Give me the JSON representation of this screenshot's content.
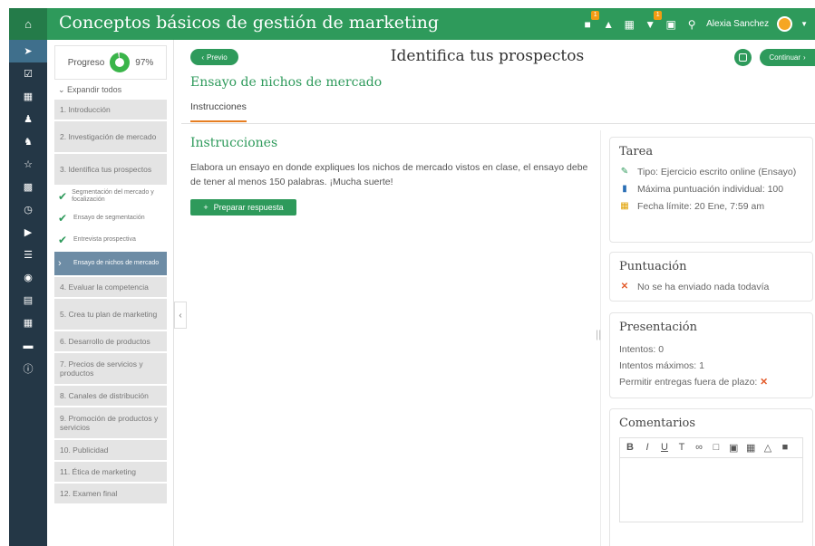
{
  "app": {
    "title": "Conceptos básicos de gestión de marketing"
  },
  "topbar": {
    "badge_1": "1",
    "badge_2": "1",
    "user_name": "Alexia Sanchez"
  },
  "outline": {
    "progress_label": "Progreso",
    "progress_percent": 97,
    "progress_text": "97%",
    "expand_label": "Expandir todos",
    "chapters_top": [
      {
        "label": "1. Introducción",
        "size": "one"
      },
      {
        "label": "2. Investigación de mercado",
        "size": "two"
      },
      {
        "label": "3. Identifica tus prospectos",
        "size": "two"
      }
    ],
    "subitems": [
      {
        "label": "Segmentación del mercado y focalización"
      },
      {
        "label": "Ensayo de segmentación"
      },
      {
        "label": "Entrevista prospectiva"
      }
    ],
    "current_item": "Ensayo de nichos de mercado",
    "chapters_bottom": [
      {
        "label": "4. Evaluar la competencia",
        "size": "one"
      },
      {
        "label": "5. Crea tu plan de marketing",
        "size": "two"
      },
      {
        "label": "6. Desarrollo de productos",
        "size": "one"
      },
      {
        "label": "7. Precios de servicios y productos",
        "size": "two"
      },
      {
        "label": "8. Canales de distribución",
        "size": "one"
      },
      {
        "label": "9. Promoción de productos y servicios",
        "size": "two"
      },
      {
        "label": "10. Publicidad",
        "size": "one"
      },
      {
        "label": "11. Ética de marketing",
        "size": "one"
      },
      {
        "label": "12. Examen final",
        "size": "one"
      }
    ]
  },
  "main": {
    "prev_label": "Previo",
    "page_title": "Identifica tus prospectos",
    "next_label": "Continuar",
    "assignment_title": "Ensayo de nichos de mercado",
    "tab_label": "Instrucciones",
    "section_title": "Instrucciones",
    "instructions": "Elabora un ensayo en donde expliques los nichos de mercado vistos en clase, el ensayo debe de tener al menos 150 palabras. ¡Mucha suerte!",
    "prepare_label": "Preparar respuesta"
  },
  "task_card": {
    "title": "Tarea",
    "type": "Tipo: Ejercicio escrito online (Ensayo)",
    "max_score": "Máxima puntuación individual: 100",
    "deadline": "Fecha límite: 20 Ene, 7:59 am"
  },
  "score_card": {
    "title": "Puntuación",
    "status": "No se ha enviado nada todavía"
  },
  "submission_card": {
    "title": "Presentación",
    "attempts": "Intentos: 0",
    "max_attempts": "Intentos máximos: 1",
    "late": "Permitir entregas fuera de plazo:"
  },
  "comments_card": {
    "title": "Comentarios"
  }
}
